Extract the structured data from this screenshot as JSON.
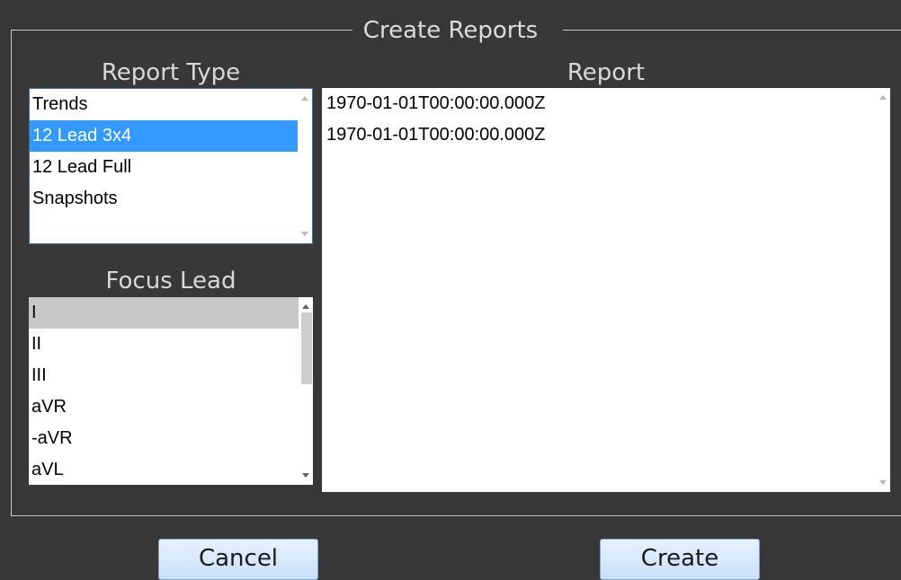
{
  "dialog": {
    "title": "Create Reports",
    "report_type_label": "Report Type",
    "focus_lead_label": "Focus Lead",
    "report_label": "Report"
  },
  "report_types": {
    "items": [
      "Trends",
      "12 Lead 3x4",
      "12 Lead Full",
      "Snapshots"
    ],
    "selected": "12 Lead 3x4"
  },
  "focus_leads": {
    "items": [
      "I",
      "II",
      "III",
      "aVR",
      "-aVR",
      "aVL"
    ],
    "selected": "I"
  },
  "reports": {
    "items": [
      "1970-01-01T00:00:00.000Z",
      "1970-01-01T00:00:00.000Z"
    ]
  },
  "buttons": {
    "cancel": "Cancel",
    "create": "Create"
  },
  "colors": {
    "background": "#383838",
    "selection": "#3399ff",
    "focus_selection": "#c8c8c8"
  }
}
